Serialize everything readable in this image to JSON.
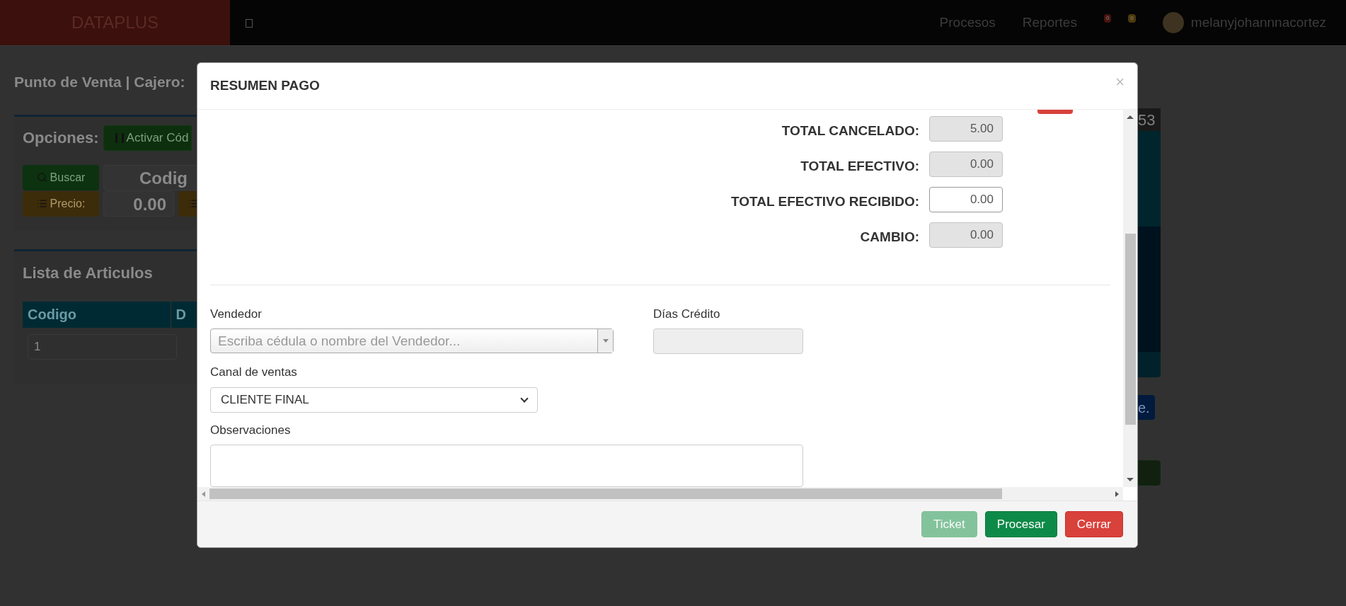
{
  "navbar": {
    "brand": "DATAPLUS",
    "menu": [
      "Procesos",
      "Reportes"
    ],
    "badges": [
      {
        "text": "0",
        "color": "#4a1410"
      },
      {
        "text": "0",
        "color": "#4d3a0c"
      }
    ],
    "user": "melanyjohannnacortez"
  },
  "page": {
    "title": "Punto de Venta | Cajero:",
    "options_label": "Opciones:",
    "activate_button": "Activar Cód",
    "search_button": "Buscar",
    "code_field": "Codig",
    "price_button": "Precio:",
    "price_value": "0.00",
    "list_title": "Lista de Articulos",
    "table_columns": [
      "Codigo",
      "D"
    ],
    "table_row": [
      "1"
    ],
    "right_header": "53",
    "right_button": "e."
  },
  "modal": {
    "title": "RESUMEN PAGO",
    "close": "×",
    "totals": [
      {
        "label": "TOTAL CANCELADO:",
        "value": "5.00",
        "readonly": true
      },
      {
        "label": "TOTAL EFECTIVO:",
        "value": "0.00",
        "readonly": true
      },
      {
        "label": "TOTAL EFECTIVO RECIBIDO:",
        "value": "0.00",
        "readonly": false
      },
      {
        "label": "CAMBIO:",
        "value": "0.00",
        "readonly": true
      }
    ],
    "seller": {
      "label": "Vendedor",
      "placeholder": "Escriba cédula o nombre del Vendedor..."
    },
    "credit_days": {
      "label": "Días Crédito"
    },
    "channel": {
      "label": "Canal de ventas",
      "value": "CLIENTE FINAL"
    },
    "notes": {
      "label": "Observaciones"
    },
    "buttons": [
      {
        "label": "Ticket",
        "kind": "ticket",
        "disabled": true
      },
      {
        "label": "Procesar",
        "kind": "process",
        "disabled": false
      },
      {
        "label": "Cerrar",
        "kind": "close",
        "disabled": false
      }
    ]
  }
}
